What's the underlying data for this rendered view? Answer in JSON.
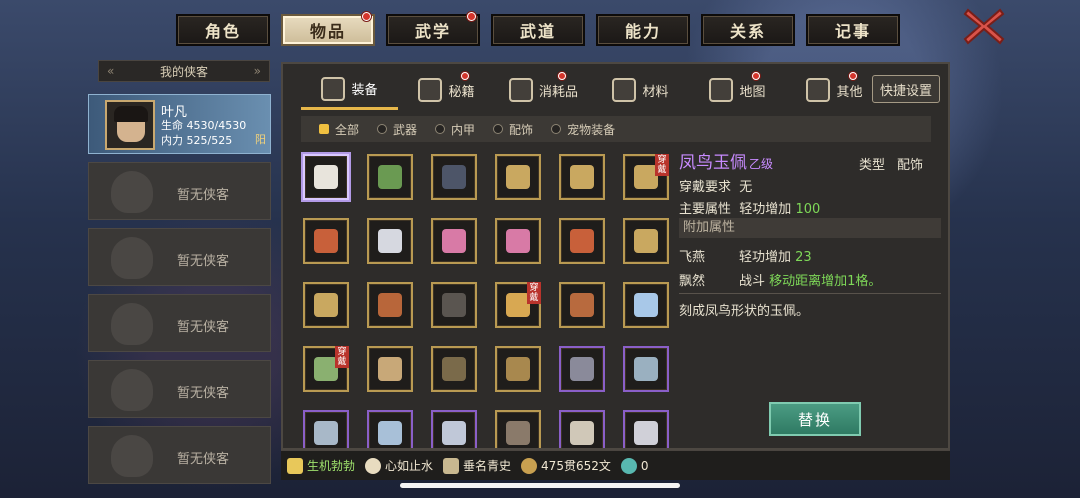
{
  "top_tabs": [
    {
      "label": "角色",
      "badge": false,
      "active": false
    },
    {
      "label": "物品",
      "badge": true,
      "active": true
    },
    {
      "label": "武学",
      "badge": true,
      "active": false
    },
    {
      "label": "武道",
      "badge": false,
      "active": false
    },
    {
      "label": "能力",
      "badge": false,
      "active": false
    },
    {
      "label": "关系",
      "badge": false,
      "active": false
    },
    {
      "label": "记事",
      "badge": false,
      "active": false
    }
  ],
  "left_panel": {
    "header": "我的侠客",
    "hero": {
      "name": "叶凡",
      "hp": "生命 4530/4530",
      "mp": "内力 525/525",
      "tag": "阳"
    },
    "empty_label": "暂无侠客",
    "empty_count": 5
  },
  "sub_tabs": [
    {
      "label": "装备",
      "badge": false,
      "active": true,
      "icon": "helmet-icon"
    },
    {
      "label": "秘籍",
      "badge": true,
      "active": false,
      "icon": "book-icon"
    },
    {
      "label": "消耗品",
      "badge": true,
      "active": false,
      "icon": "potion-icon"
    },
    {
      "label": "材料",
      "badge": false,
      "active": false,
      "icon": "herb-icon"
    },
    {
      "label": "地图",
      "badge": true,
      "active": false,
      "icon": "map-icon"
    },
    {
      "label": "其他",
      "badge": true,
      "active": false,
      "icon": "misc-icon"
    }
  ],
  "quick_settings": "快捷设置",
  "filters": [
    {
      "label": "全部",
      "on": true
    },
    {
      "label": "武器",
      "on": false
    },
    {
      "label": "内甲",
      "on": false
    },
    {
      "label": "配饰",
      "on": false
    },
    {
      "label": "宠物装备",
      "on": false
    }
  ],
  "worn_label": "穿戴",
  "grid_items": [
    {
      "color": "#e8e4dc",
      "frame": "selected",
      "worn": false
    },
    {
      "color": "#6a9a52",
      "frame": "gold",
      "worn": false
    },
    {
      "color": "#4d5568",
      "frame": "gold",
      "worn": false
    },
    {
      "color": "#c9a860",
      "frame": "gold",
      "worn": false
    },
    {
      "color": "#c9a860",
      "frame": "gold",
      "worn": false
    },
    {
      "color": "#c9a860",
      "frame": "gold",
      "worn": true
    },
    {
      "color": "#c8603a",
      "frame": "gold",
      "worn": false
    },
    {
      "color": "#d6d8e0",
      "frame": "gold",
      "worn": false
    },
    {
      "color": "#d87aa6",
      "frame": "gold",
      "worn": false
    },
    {
      "color": "#d87aa6",
      "frame": "gold",
      "worn": false
    },
    {
      "color": "#c8603a",
      "frame": "gold",
      "worn": false
    },
    {
      "color": "#c9a860",
      "frame": "gold",
      "worn": false
    },
    {
      "color": "#c9a860",
      "frame": "gold",
      "worn": false
    },
    {
      "color": "#b8663a",
      "frame": "gold",
      "worn": false
    },
    {
      "color": "#5a5550",
      "frame": "gold",
      "worn": false
    },
    {
      "color": "#d8a852",
      "frame": "gold",
      "worn": true
    },
    {
      "color": "#b86a3e",
      "frame": "gold",
      "worn": false
    },
    {
      "color": "#a8c8e8",
      "frame": "gold",
      "worn": false
    },
    {
      "color": "#8ab070",
      "frame": "gold",
      "worn": true
    },
    {
      "color": "#c8a878",
      "frame": "gold",
      "worn": false
    },
    {
      "color": "#7a6a4a",
      "frame": "gold",
      "worn": false
    },
    {
      "color": "#a8884e",
      "frame": "gold",
      "worn": false
    },
    {
      "color": "#8a8a9a",
      "frame": "purple",
      "worn": false
    },
    {
      "color": "#9ab0c0",
      "frame": "purple",
      "worn": false
    },
    {
      "color": "#a8b8c8",
      "frame": "purple",
      "worn": false
    },
    {
      "color": "#a8c0d8",
      "frame": "purple",
      "worn": false
    },
    {
      "color": "#c0c8d8",
      "frame": "purple",
      "worn": false
    },
    {
      "color": "#8a7a6a",
      "frame": "gold",
      "worn": false
    },
    {
      "color": "#d0c8b8",
      "frame": "purple",
      "worn": false
    },
    {
      "color": "#d0d0d8",
      "frame": "purple",
      "worn": false
    }
  ],
  "detail": {
    "name": "凤鸟玉佩",
    "grade": "乙级",
    "type_label": "类型",
    "type_value": "配饰",
    "require_label": "穿戴要求",
    "require_value": "无",
    "main_attr_label": "主要属性",
    "main_attr_text": "轻功增加",
    "main_attr_value": "100",
    "extra_header": "附加属性",
    "extra": [
      {
        "name": "飞燕",
        "text": "轻功增加",
        "value": "23"
      },
      {
        "name": "飘然",
        "text": "战斗",
        "value": "移动距离增加1格。"
      }
    ],
    "description": "刻成凤鸟形状的玉佩。"
  },
  "replace_label": "替换",
  "bottom_bar": {
    "skill1": "生机勃勃",
    "skill2": "心如止水",
    "skill3": "垂名青史",
    "money": "475贯652文",
    "coins": "0"
  },
  "colors": {
    "accent": "#e6b74a",
    "rare_purple": "#c88bff",
    "green": "#7ed858",
    "badge_red": "#d4352c"
  }
}
